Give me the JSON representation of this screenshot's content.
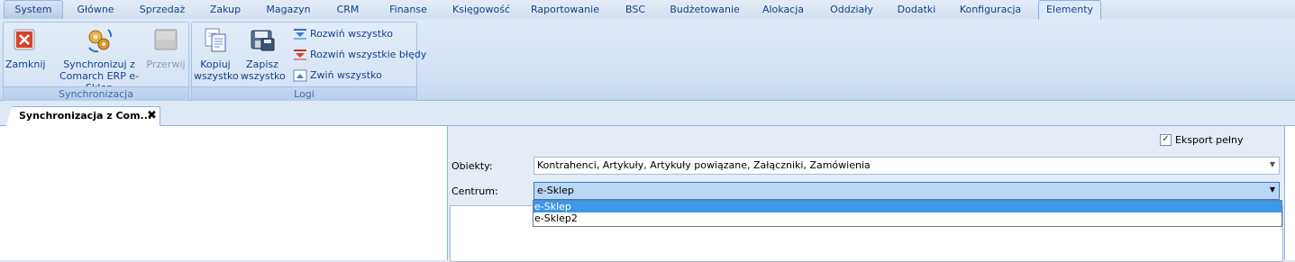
{
  "menu": {
    "tabs": [
      {
        "label": "System"
      },
      {
        "label": "Główne"
      },
      {
        "label": "Sprzedaż"
      },
      {
        "label": "Zakup"
      },
      {
        "label": "Magazyn"
      },
      {
        "label": "CRM"
      },
      {
        "label": "Finanse"
      },
      {
        "label": "Księgowość"
      },
      {
        "label": "Raportowanie"
      },
      {
        "label": "BSC"
      },
      {
        "label": "Budżetowanie"
      },
      {
        "label": "Alokacja"
      },
      {
        "label": "Oddziały"
      },
      {
        "label": "Dodatki"
      },
      {
        "label": "Konfiguracja"
      },
      {
        "label": "Elementy"
      }
    ],
    "active_tab": "Elementy"
  },
  "ribbon": {
    "sync_group": {
      "label": "Synchronizacja",
      "close_label": "Zamknij",
      "sync_label_line1": "Synchronizuj z",
      "sync_label_line2": "Comarch ERP e-Sklep",
      "stop_label": "Przerwij"
    },
    "logs_group": {
      "label": "Logi",
      "copy_line1": "Kopiuj",
      "copy_line2": "wszystko",
      "save_line1": "Zapisz",
      "save_line2": "wszystko",
      "expand_all": "Rozwiń wszystko",
      "expand_errors": "Rozwiń wszystkie błędy",
      "collapse_all": "Zwiń wszystko"
    }
  },
  "document_tab": {
    "label": "Synchronizacja z Com...",
    "close_glyph": "✖"
  },
  "form": {
    "export_full_label": "Eksport pełny",
    "export_full_checked": true,
    "objects_label": "Obiekty:",
    "objects_value": "Kontrahenci, Artykuły, Artykuły powiązane, Załączniki, Zamówienia",
    "center_label": "Centrum:",
    "center_value": "e-Sklep",
    "center_options": [
      "e-Sklep",
      "e-Sklep2"
    ],
    "center_selected_index": 0
  },
  "colors": {
    "accent": "#15428b",
    "selection": "#3c98e8",
    "focus_fill": "#b9d7f7"
  }
}
